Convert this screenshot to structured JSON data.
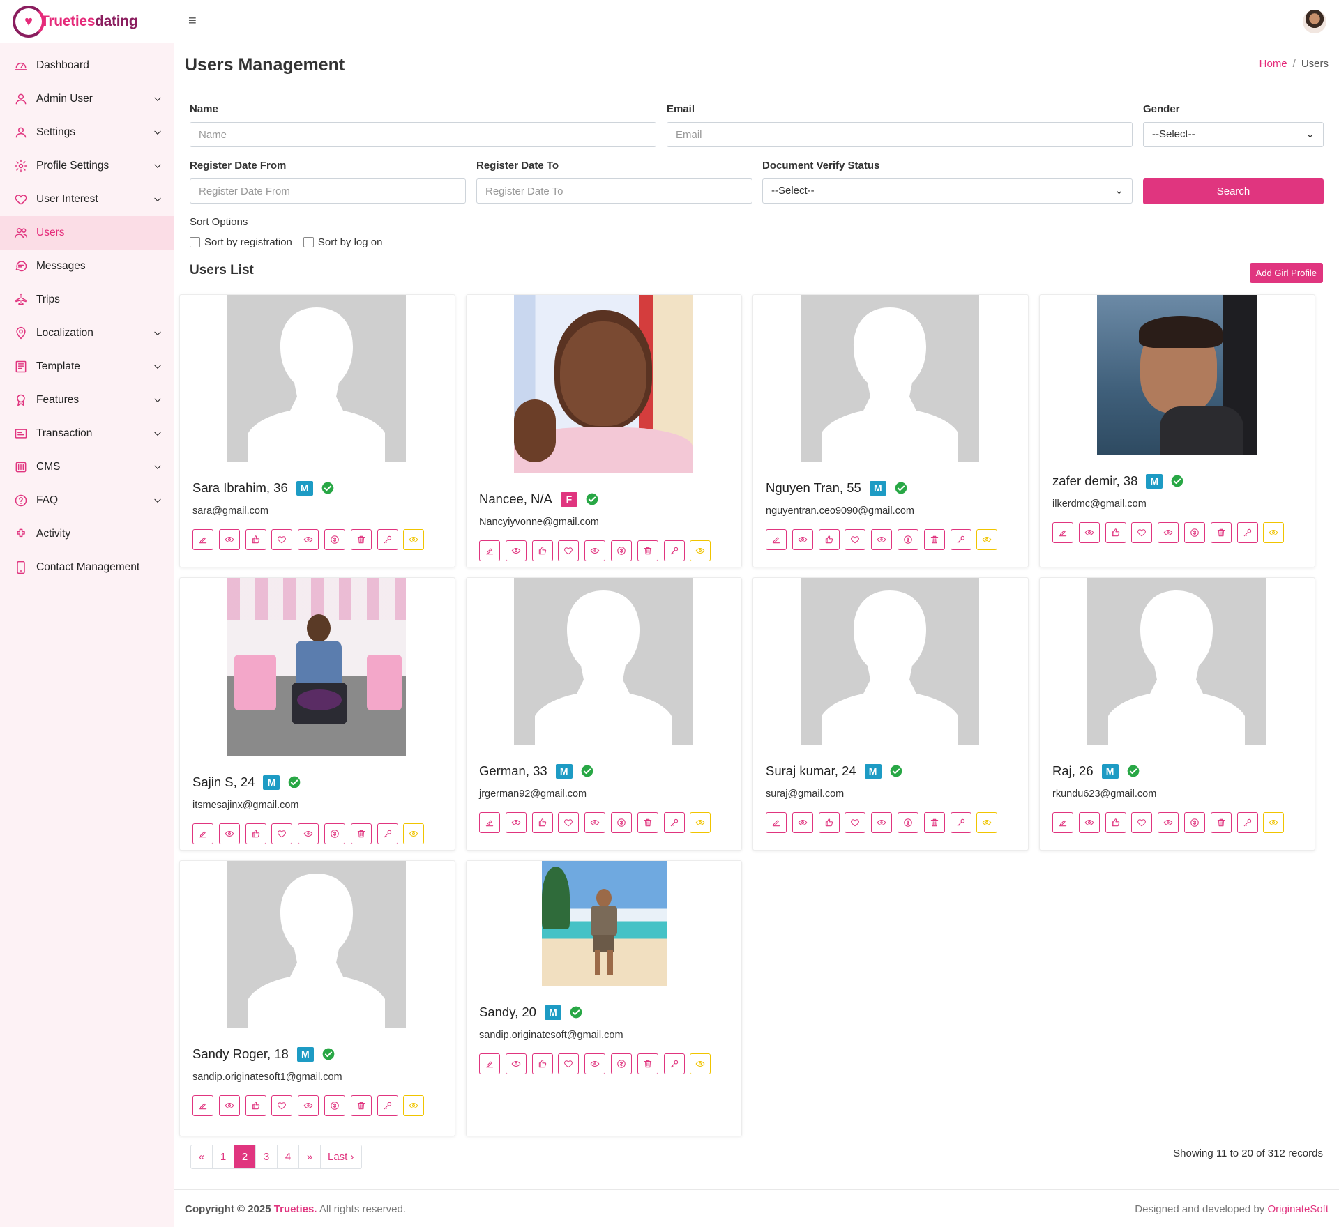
{
  "brand": {
    "name_part1": "Trueties",
    "name_part2": "dating"
  },
  "sidebar": {
    "items": [
      {
        "label": "Dashboard",
        "icon": "dashboard-icon",
        "chevron": false,
        "active": false
      },
      {
        "label": "Admin User",
        "icon": "user-icon",
        "chevron": true,
        "active": false
      },
      {
        "label": "Settings",
        "icon": "user-icon",
        "chevron": true,
        "active": false
      },
      {
        "label": "Profile Settings",
        "icon": "gear-icon",
        "chevron": true,
        "active": false
      },
      {
        "label": "User Interest",
        "icon": "heart-icon",
        "chevron": true,
        "active": false
      },
      {
        "label": "Users",
        "icon": "users-icon",
        "chevron": false,
        "active": true
      },
      {
        "label": "Messages",
        "icon": "chat-icon",
        "chevron": false,
        "active": false
      },
      {
        "label": "Trips",
        "icon": "plane-icon",
        "chevron": false,
        "active": false
      },
      {
        "label": "Localization",
        "icon": "map-pin-icon",
        "chevron": true,
        "active": false
      },
      {
        "label": "Template",
        "icon": "template-icon",
        "chevron": true,
        "active": false
      },
      {
        "label": "Features",
        "icon": "award-icon",
        "chevron": true,
        "active": false
      },
      {
        "label": "Transaction",
        "icon": "transaction-icon",
        "chevron": true,
        "active": false
      },
      {
        "label": "CMS",
        "icon": "cms-icon",
        "chevron": true,
        "active": false
      },
      {
        "label": "FAQ",
        "icon": "question-icon",
        "chevron": true,
        "active": false
      },
      {
        "label": "Activity",
        "icon": "activity-icon",
        "chevron": false,
        "active": false
      },
      {
        "label": "Contact Management",
        "icon": "phone-icon",
        "chevron": false,
        "active": false
      }
    ]
  },
  "header": {
    "menu_icon": "hamburger-icon"
  },
  "page": {
    "title": "Users Management",
    "breadcrumb": {
      "home": "Home",
      "sep": "/",
      "current": "Users"
    }
  },
  "filters": {
    "name_label": "Name",
    "name_placeholder": "Name",
    "email_label": "Email",
    "email_placeholder": "Email",
    "gender_label": "Gender",
    "gender_value": "--Select--",
    "reg_from_label": "Register Date From",
    "reg_from_placeholder": "Register Date From",
    "reg_to_label": "Register Date To",
    "reg_to_placeholder": "Register Date To",
    "doc_label": "Document Verify Status",
    "doc_value": "--Select--",
    "search_label": "Search",
    "sort_label": "Sort Options",
    "sort_registration": "Sort by registration",
    "sort_logon": "Sort by log on"
  },
  "users_list": {
    "title": "Users List",
    "add_button": "Add Girl Profile",
    "users": [
      {
        "name": "Sara Ibrahim, 36",
        "gender": "M",
        "email": "sara@gmail.com",
        "photo": "placeholder"
      },
      {
        "name": "Nancee, N/A",
        "gender": "F",
        "email": "Nancyiyvonne@gmail.com",
        "photo": "woman-selfie"
      },
      {
        "name": "Nguyen Tran, 55",
        "gender": "M",
        "email": "nguyentran.ceo9090@gmail.com",
        "photo": "placeholder"
      },
      {
        "name": "zafer demir, 38",
        "gender": "M",
        "email": "ilkerdmc@gmail.com",
        "photo": "man-sea"
      },
      {
        "name": "Sajin S, 24",
        "gender": "M",
        "email": "itsmesajinx@gmail.com",
        "photo": "man-cafe"
      },
      {
        "name": "German, 33",
        "gender": "M",
        "email": "jrgerman92@gmail.com",
        "photo": "placeholder"
      },
      {
        "name": "Suraj kumar, 24",
        "gender": "M",
        "email": "suraj@gmail.com",
        "photo": "placeholder"
      },
      {
        "name": "Raj, 26",
        "gender": "M",
        "email": "rkundu623@gmail.com",
        "photo": "placeholder"
      },
      {
        "name": "Sandy Roger, 18",
        "gender": "M",
        "email": "sandip.originatesoft1@gmail.com",
        "photo": "placeholder"
      },
      {
        "name": "Sandy, 20",
        "gender": "M",
        "email": "sandip.originatesoft@gmail.com",
        "photo": "man-beach"
      }
    ],
    "action_icons": [
      "edit-icon",
      "view-icon",
      "like-icon",
      "heart-icon",
      "eye-icon",
      "coin-icon",
      "trash-icon",
      "key-icon",
      "hide-eye-icon"
    ]
  },
  "pagination": {
    "pages": [
      "«",
      "1",
      "2",
      "3",
      "4",
      "»",
      "Last ›"
    ],
    "active_page": "2",
    "showing": "Showing 11 to 20 of 312 records"
  },
  "footer": {
    "copyright_prefix": "Copyright © 2025",
    "brand": "Trueties.",
    "rights": "All rights reserved.",
    "designed_prefix": "Designed and developed by",
    "developer": "OriginateSoft"
  },
  "colors": {
    "accent": "#e0357f",
    "badge_male": "#1d9bc4",
    "badge_female": "#e0357f",
    "verified": "#28a745",
    "warning": "#f0c400"
  }
}
